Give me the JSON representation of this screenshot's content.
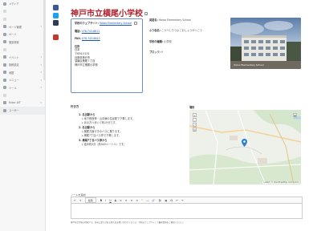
{
  "sidebar": {
    "items": [
      {
        "label": "メディア",
        "chev": ""
      },
      {
        "label": "",
        "chev": ""
      },
      {
        "label": "",
        "chev": ""
      },
      {
        "label": "ページ管理",
        "chev": "▾"
      },
      {
        "label": "ページ",
        "chev": ""
      },
      {
        "label": "施設検索",
        "chev": ""
      },
      {
        "label": "",
        "chev": ""
      },
      {
        "label": "イベント",
        "chev": "▾"
      },
      {
        "label": "投稿設定",
        "chev": "▾"
      },
      {
        "label": "地図",
        "chev": "▾"
      },
      {
        "label": "メニュー",
        "chev": "▾"
      },
      {
        "label": "ツール",
        "chev": "▾"
      },
      {
        "label": "",
        "chev": ""
      },
      {
        "label": "Rubic AIT",
        "chev": "▾"
      },
      {
        "label": "ユーザー",
        "chev": ""
      }
    ]
  },
  "title": "神戸市立横尾小学校",
  "info": {
    "website_label": "学校のウェブサイト:",
    "website_link": "Yokoo Elementary School",
    "tel_label": "電話:",
    "tel_value": "078-743-8611",
    "fax_label": "FAX:",
    "fax_value": "078-743-8612",
    "address_label": "住所",
    "address_lines": [
      "日本",
      "〒654-0131",
      "兵庫県神戸市",
      "須磨区横尾７丁目",
      "神戸市立横尾小学校"
    ]
  },
  "right": {
    "en_label": "英語名:",
    "en_value": "Yokoo Elementary School",
    "furi_label": "ふり仮名:",
    "furi_value": "こうべしりつよこおしょうがっこう",
    "type_label": "学校の種類:",
    "type_value": "小学校",
    "block_label": "ブロック:",
    "block_value": "9"
  },
  "photo": {
    "caption": "Yokoo Elementary School"
  },
  "access": {
    "heading": "行き方",
    "groups": [
      {
        "title": "1. 名谷駅から",
        "items": [
          "地下鉄西神・山手線の名谷駅で下車します。",
          "北の方へ歩いて約15分です。"
        ]
      },
      {
        "title": "2. 名谷駅から",
        "items": [
          "横尾方面行きのバスに乗ります。",
          "横尾7丁目バス停で下車します。"
        ]
      },
      {
        "title": "3. 横尾7丁目バス停から",
        "items": [
          "徒歩約5分（約400メートル）です。"
        ]
      }
    ]
  },
  "map": {
    "heading": "場所",
    "credit": "Leaflet | © OpenStreetMap contributors"
  },
  "editor": {
    "label": "ノートを追加",
    "paragraph_select": "段落",
    "toolbar_glyphs": [
      "B",
      "I",
      "U",
      "S",
      "≡",
      "≡",
      "≡",
      "≡",
      "“",
      "—",
      "🔗",
      "⛓",
      "▦",
      "Ω",
      "↶",
      "↷"
    ]
  },
  "footnote": "神戸市立学校の情報です。内容に誤りがある場合はお問い合わせください。学校のウェブサイトで最新情報をご確認ください。"
}
